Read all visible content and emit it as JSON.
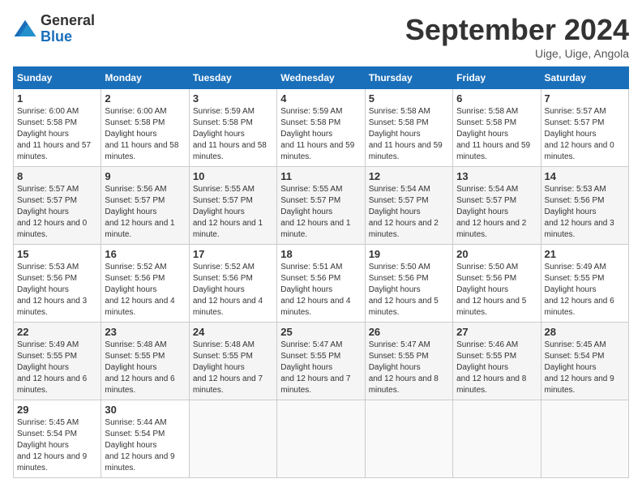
{
  "header": {
    "logo_general": "General",
    "logo_blue": "Blue",
    "month_title": "September 2024",
    "location": "Uige, Uige, Angola"
  },
  "calendar": {
    "columns": [
      "Sunday",
      "Monday",
      "Tuesday",
      "Wednesday",
      "Thursday",
      "Friday",
      "Saturday"
    ],
    "weeks": [
      [
        null,
        null,
        null,
        null,
        null,
        null,
        null
      ]
    ],
    "days": {
      "1": {
        "sunrise": "6:00 AM",
        "sunset": "5:58 PM",
        "daylight": "11 hours and 57 minutes."
      },
      "2": {
        "sunrise": "6:00 AM",
        "sunset": "5:58 PM",
        "daylight": "11 hours and 58 minutes."
      },
      "3": {
        "sunrise": "5:59 AM",
        "sunset": "5:58 PM",
        "daylight": "11 hours and 58 minutes."
      },
      "4": {
        "sunrise": "5:59 AM",
        "sunset": "5:58 PM",
        "daylight": "11 hours and 59 minutes."
      },
      "5": {
        "sunrise": "5:58 AM",
        "sunset": "5:58 PM",
        "daylight": "11 hours and 59 minutes."
      },
      "6": {
        "sunrise": "5:58 AM",
        "sunset": "5:58 PM",
        "daylight": "11 hours and 59 minutes."
      },
      "7": {
        "sunrise": "5:57 AM",
        "sunset": "5:57 PM",
        "daylight": "12 hours and 0 minutes."
      },
      "8": {
        "sunrise": "5:57 AM",
        "sunset": "5:57 PM",
        "daylight": "12 hours and 0 minutes."
      },
      "9": {
        "sunrise": "5:56 AM",
        "sunset": "5:57 PM",
        "daylight": "12 hours and 1 minute."
      },
      "10": {
        "sunrise": "5:55 AM",
        "sunset": "5:57 PM",
        "daylight": "12 hours and 1 minute."
      },
      "11": {
        "sunrise": "5:55 AM",
        "sunset": "5:57 PM",
        "daylight": "12 hours and 1 minute."
      },
      "12": {
        "sunrise": "5:54 AM",
        "sunset": "5:57 PM",
        "daylight": "12 hours and 2 minutes."
      },
      "13": {
        "sunrise": "5:54 AM",
        "sunset": "5:57 PM",
        "daylight": "12 hours and 2 minutes."
      },
      "14": {
        "sunrise": "5:53 AM",
        "sunset": "5:56 PM",
        "daylight": "12 hours and 3 minutes."
      },
      "15": {
        "sunrise": "5:53 AM",
        "sunset": "5:56 PM",
        "daylight": "12 hours and 3 minutes."
      },
      "16": {
        "sunrise": "5:52 AM",
        "sunset": "5:56 PM",
        "daylight": "12 hours and 4 minutes."
      },
      "17": {
        "sunrise": "5:52 AM",
        "sunset": "5:56 PM",
        "daylight": "12 hours and 4 minutes."
      },
      "18": {
        "sunrise": "5:51 AM",
        "sunset": "5:56 PM",
        "daylight": "12 hours and 4 minutes."
      },
      "19": {
        "sunrise": "5:50 AM",
        "sunset": "5:56 PM",
        "daylight": "12 hours and 5 minutes."
      },
      "20": {
        "sunrise": "5:50 AM",
        "sunset": "5:56 PM",
        "daylight": "12 hours and 5 minutes."
      },
      "21": {
        "sunrise": "5:49 AM",
        "sunset": "5:55 PM",
        "daylight": "12 hours and 6 minutes."
      },
      "22": {
        "sunrise": "5:49 AM",
        "sunset": "5:55 PM",
        "daylight": "12 hours and 6 minutes."
      },
      "23": {
        "sunrise": "5:48 AM",
        "sunset": "5:55 PM",
        "daylight": "12 hours and 6 minutes."
      },
      "24": {
        "sunrise": "5:48 AM",
        "sunset": "5:55 PM",
        "daylight": "12 hours and 7 minutes."
      },
      "25": {
        "sunrise": "5:47 AM",
        "sunset": "5:55 PM",
        "daylight": "12 hours and 7 minutes."
      },
      "26": {
        "sunrise": "5:47 AM",
        "sunset": "5:55 PM",
        "daylight": "12 hours and 8 minutes."
      },
      "27": {
        "sunrise": "5:46 AM",
        "sunset": "5:55 PM",
        "daylight": "12 hours and 8 minutes."
      },
      "28": {
        "sunrise": "5:45 AM",
        "sunset": "5:54 PM",
        "daylight": "12 hours and 9 minutes."
      },
      "29": {
        "sunrise": "5:45 AM",
        "sunset": "5:54 PM",
        "daylight": "12 hours and 9 minutes."
      },
      "30": {
        "sunrise": "5:44 AM",
        "sunset": "5:54 PM",
        "daylight": "12 hours and 9 minutes."
      }
    }
  }
}
